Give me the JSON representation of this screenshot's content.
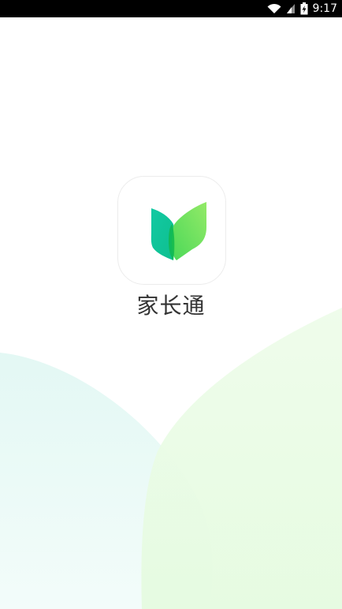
{
  "status_bar": {
    "time": "9:17",
    "icons": [
      "wifi-icon",
      "signal-icon",
      "battery-charging-icon"
    ]
  },
  "splash": {
    "app_name": "家长通",
    "logo_icon": "open-book-icon"
  },
  "colors": {
    "brand_teal": "#10c7a0",
    "brand_green": "#5ee04a",
    "bg_left_wave": "#e6faf7",
    "bg_right_wave": "#e7fbe3"
  }
}
